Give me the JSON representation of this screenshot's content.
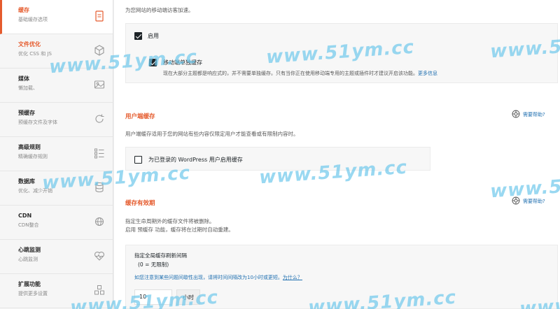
{
  "sidebar": {
    "items": [
      {
        "title": "缓存",
        "subtitle": "基础缓存选项",
        "icon": "page-icon",
        "active": true
      },
      {
        "title": "文件优化",
        "subtitle": "优化 CSS 和 JS",
        "icon": "cube-icon",
        "accent": true
      },
      {
        "title": "媒体",
        "subtitle": "懒加载、",
        "icon": "image-icon"
      },
      {
        "title": "预缓存",
        "subtitle": "预缓存文件及字体",
        "icon": "refresh-icon"
      },
      {
        "title": "高级规则",
        "subtitle": "精确缓存规则",
        "icon": "list-icon"
      },
      {
        "title": "数据库",
        "subtitle": "优化、减少开销",
        "icon": "database-icon"
      },
      {
        "title": "CDN",
        "subtitle": "CDN整合",
        "icon": "cdn-icon"
      },
      {
        "title": "心跳监测",
        "subtitle": "心跳监测",
        "icon": "heartbeat-icon"
      },
      {
        "title": "扩展功能",
        "subtitle": "提供更多设置",
        "icon": "addons-icon"
      }
    ]
  },
  "mobile": {
    "intro": "为您网站的移动端访客加速。",
    "enable_label": "启用",
    "enable_checked": true,
    "separate_label": "移动端单独缓存",
    "separate_checked": true,
    "separate_desc": "现在大部分主题都是响应式的，并不需要单独缓存。只有当你正在使用移动端专用的主题或插件时才建议开启该功能。",
    "more_info": "更多信息"
  },
  "user_cache": {
    "heading": "用户端缓存",
    "help": "需要帮助?",
    "desc": "用户端缓存适用于您的网站有些内容仅限定用户才能查看或有限制内容时。",
    "option_label": "为已登录的 WordPress 用户启用缓存",
    "option_checked": false
  },
  "lifespan": {
    "heading": "缓存有效期",
    "help": "需要帮助?",
    "desc1": "指定生命周期外的缓存文件将被删除。",
    "desc2": "启用 预缓存 功能，缓存将在过期时自动重建。",
    "field_label": "指定全局缓存刷新间隔",
    "field_hint": "(0 = 无限制)",
    "note": "如您注意到某些问题间歇性出现，请将时间间隔改为10小时或更短。",
    "note_link": "为什么？",
    "value": "10",
    "unit": "小时"
  },
  "watermark": "www.51ym.cc",
  "colors": {
    "accent": "#e55b2d",
    "link": "#2271b1",
    "watermark": "#6ec8eb"
  }
}
